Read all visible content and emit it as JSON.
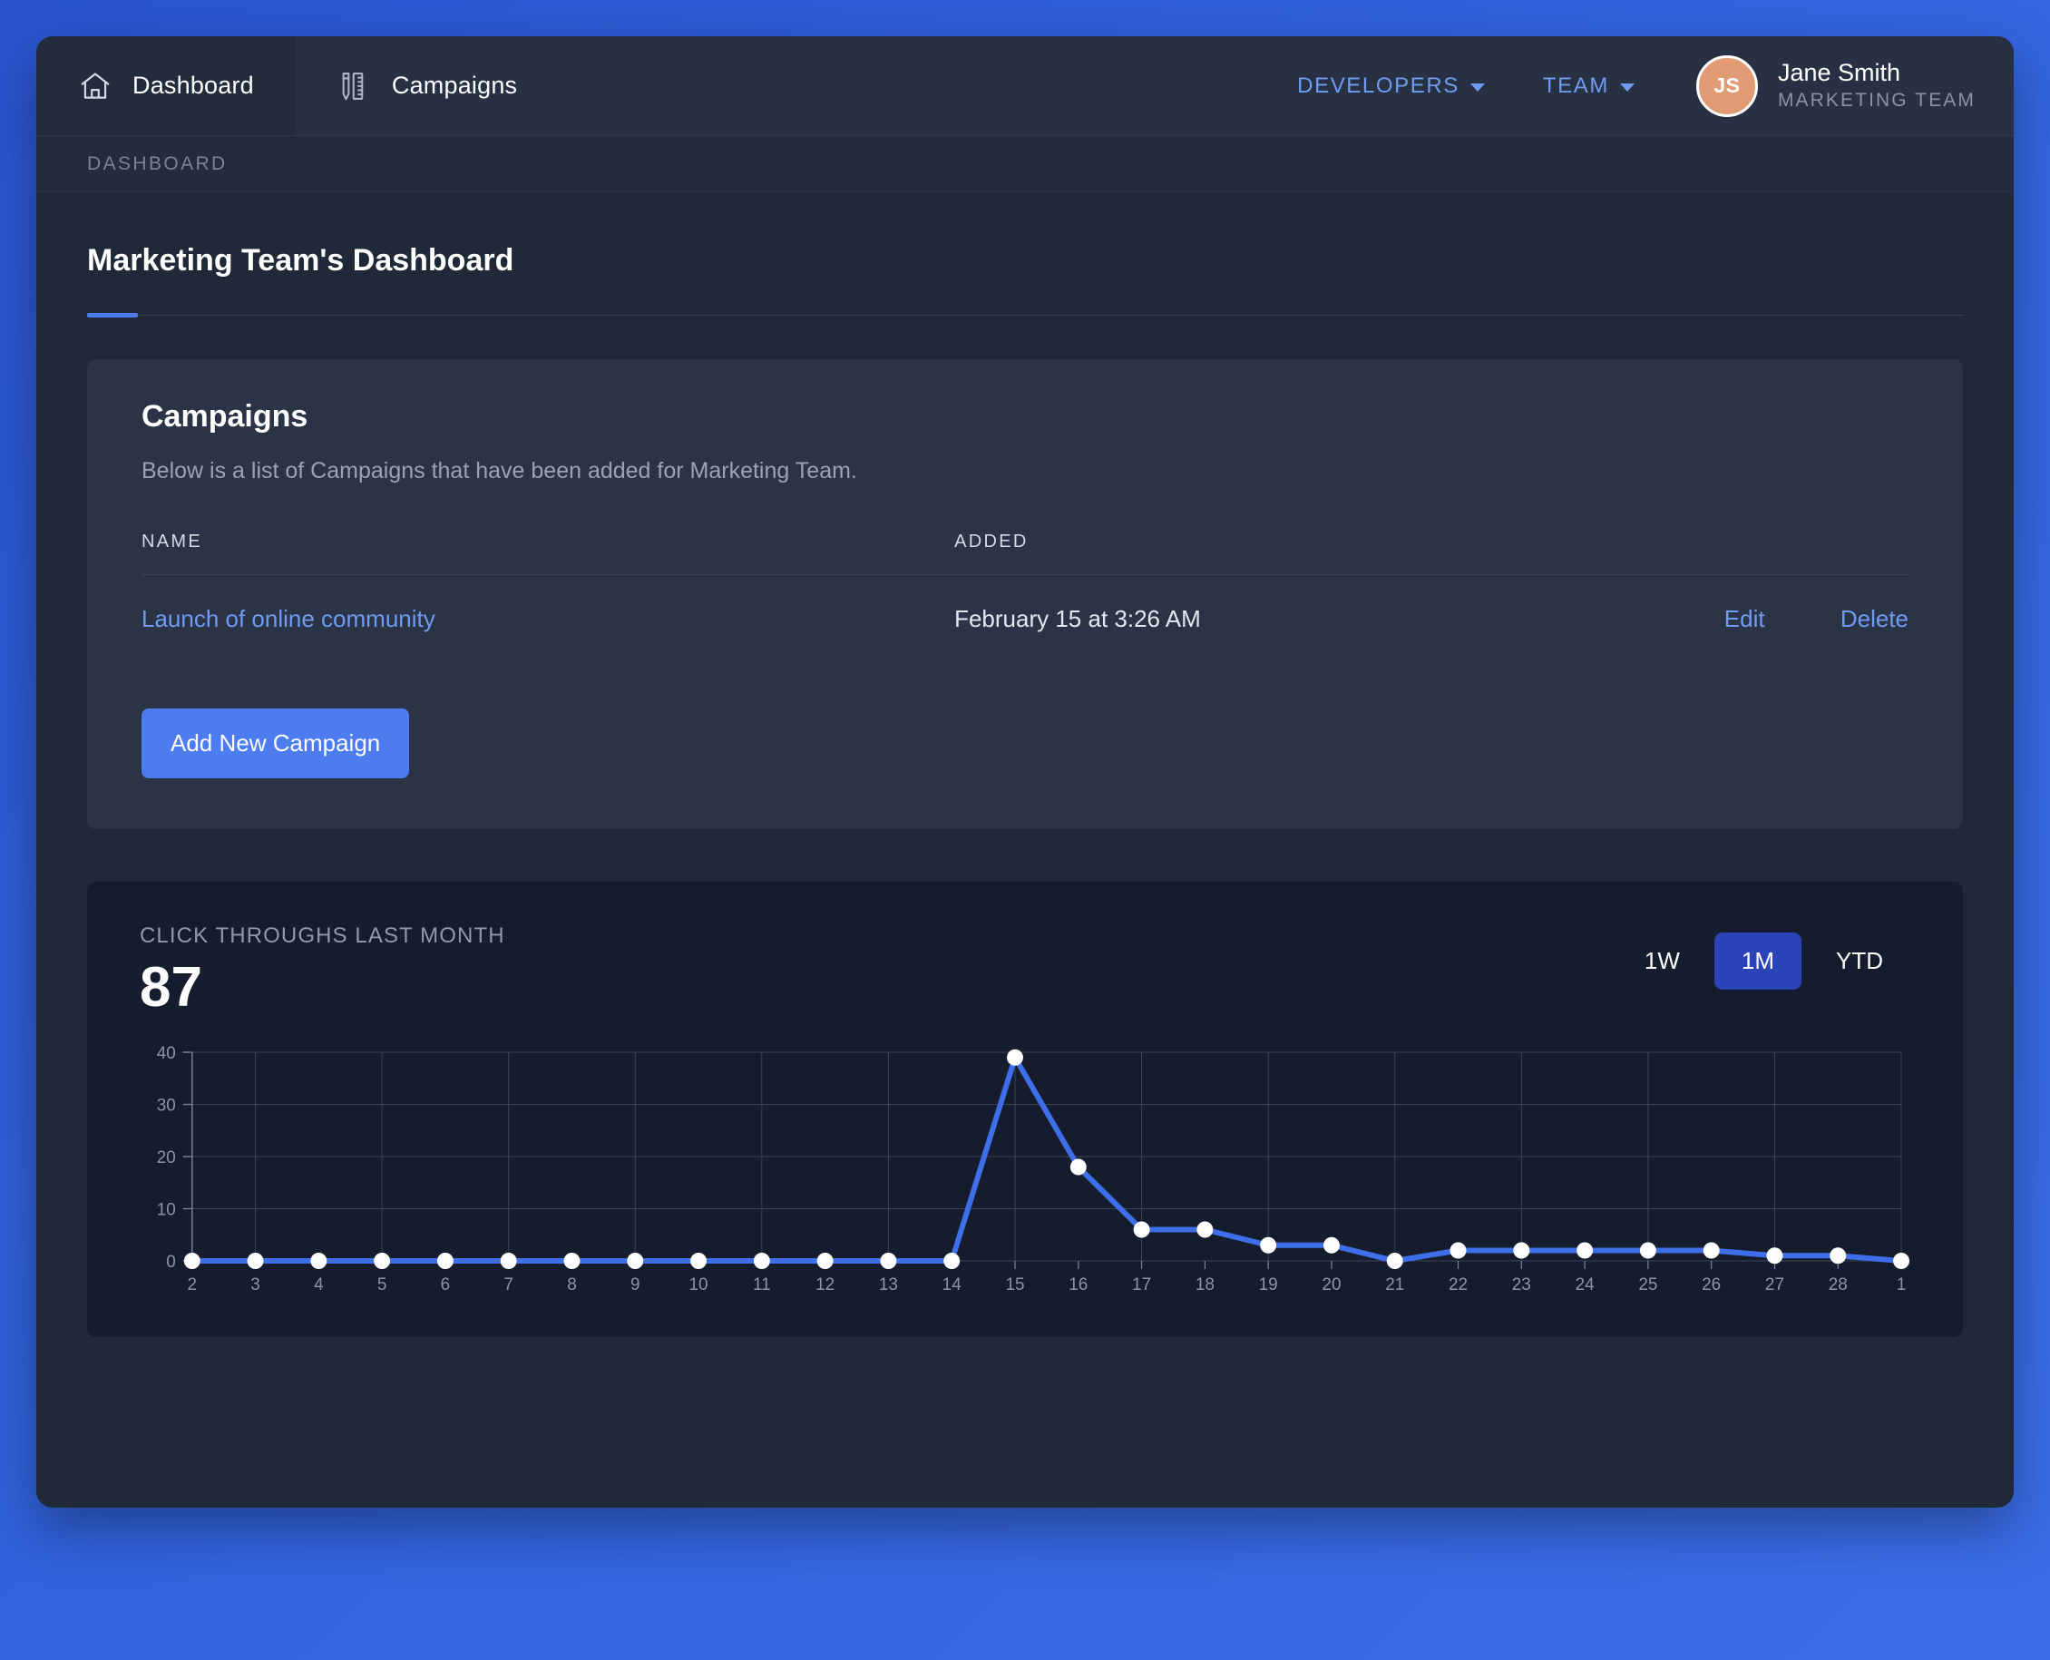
{
  "nav": {
    "tabs": [
      {
        "label": "Dashboard",
        "icon": "home-icon",
        "active": true
      },
      {
        "label": "Campaigns",
        "icon": "pencil-ruler-icon",
        "active": false
      }
    ],
    "links": [
      {
        "label": "DEVELOPERS",
        "icon": "chevron-down-icon"
      },
      {
        "label": "TEAM",
        "icon": "chevron-down-icon"
      }
    ],
    "user": {
      "initials": "JS",
      "name": "Jane Smith",
      "team": "MARKETING TEAM"
    }
  },
  "breadcrumb": "DASHBOARD",
  "page": {
    "title": "Marketing Team's Dashboard"
  },
  "campaigns_card": {
    "title": "Campaigns",
    "subtitle": "Below is a list of Campaigns that have been added for Marketing Team.",
    "columns": [
      "NAME",
      "ADDED"
    ],
    "rows": [
      {
        "name": "Launch of online community",
        "added": "February 15 at 3:26 AM",
        "edit_label": "Edit",
        "delete_label": "Delete"
      }
    ],
    "add_button": "Add New Campaign"
  },
  "chart_card": {
    "label": "CLICK THROUGHS LAST MONTH",
    "value": "87",
    "ranges": [
      {
        "label": "1W",
        "active": false
      },
      {
        "label": "1M",
        "active": true
      },
      {
        "label": "YTD",
        "active": false
      }
    ]
  },
  "colors": {
    "accent_blue": "#4d7cf0",
    "link_blue": "#6f9bf0",
    "active_range": "#2b43b8",
    "page_bg": "#1f2937",
    "card_bg": "#2b3447",
    "chart_bg": "#141c2e",
    "avatar_bg": "#e09b74",
    "grid": "#3b4558"
  },
  "chart_data": {
    "type": "line",
    "title": "CLICK THROUGHS LAST MONTH",
    "xlabel": "",
    "ylabel": "",
    "grid": true,
    "legend": false,
    "ylim": [
      0,
      40
    ],
    "yticks": [
      0,
      10,
      20,
      30,
      40
    ],
    "categories": [
      "2",
      "3",
      "4",
      "5",
      "6",
      "7",
      "8",
      "9",
      "10",
      "11",
      "12",
      "13",
      "14",
      "15",
      "16",
      "17",
      "18",
      "19",
      "20",
      "21",
      "22",
      "23",
      "24",
      "25",
      "26",
      "27",
      "28",
      "1"
    ],
    "values": [
      0,
      0,
      0,
      0,
      0,
      0,
      0,
      0,
      0,
      0,
      0,
      0,
      0,
      39,
      18,
      6,
      6,
      3,
      3,
      0,
      2,
      2,
      2,
      2,
      2,
      1,
      1,
      0
    ],
    "series": [
      {
        "name": "Click throughs",
        "color": "#3f6fe8",
        "marker_color": "#ffffff",
        "values": [
          0,
          0,
          0,
          0,
          0,
          0,
          0,
          0,
          0,
          0,
          0,
          0,
          0,
          39,
          18,
          6,
          6,
          3,
          3,
          0,
          2,
          2,
          2,
          2,
          2,
          1,
          1,
          0
        ]
      }
    ]
  }
}
